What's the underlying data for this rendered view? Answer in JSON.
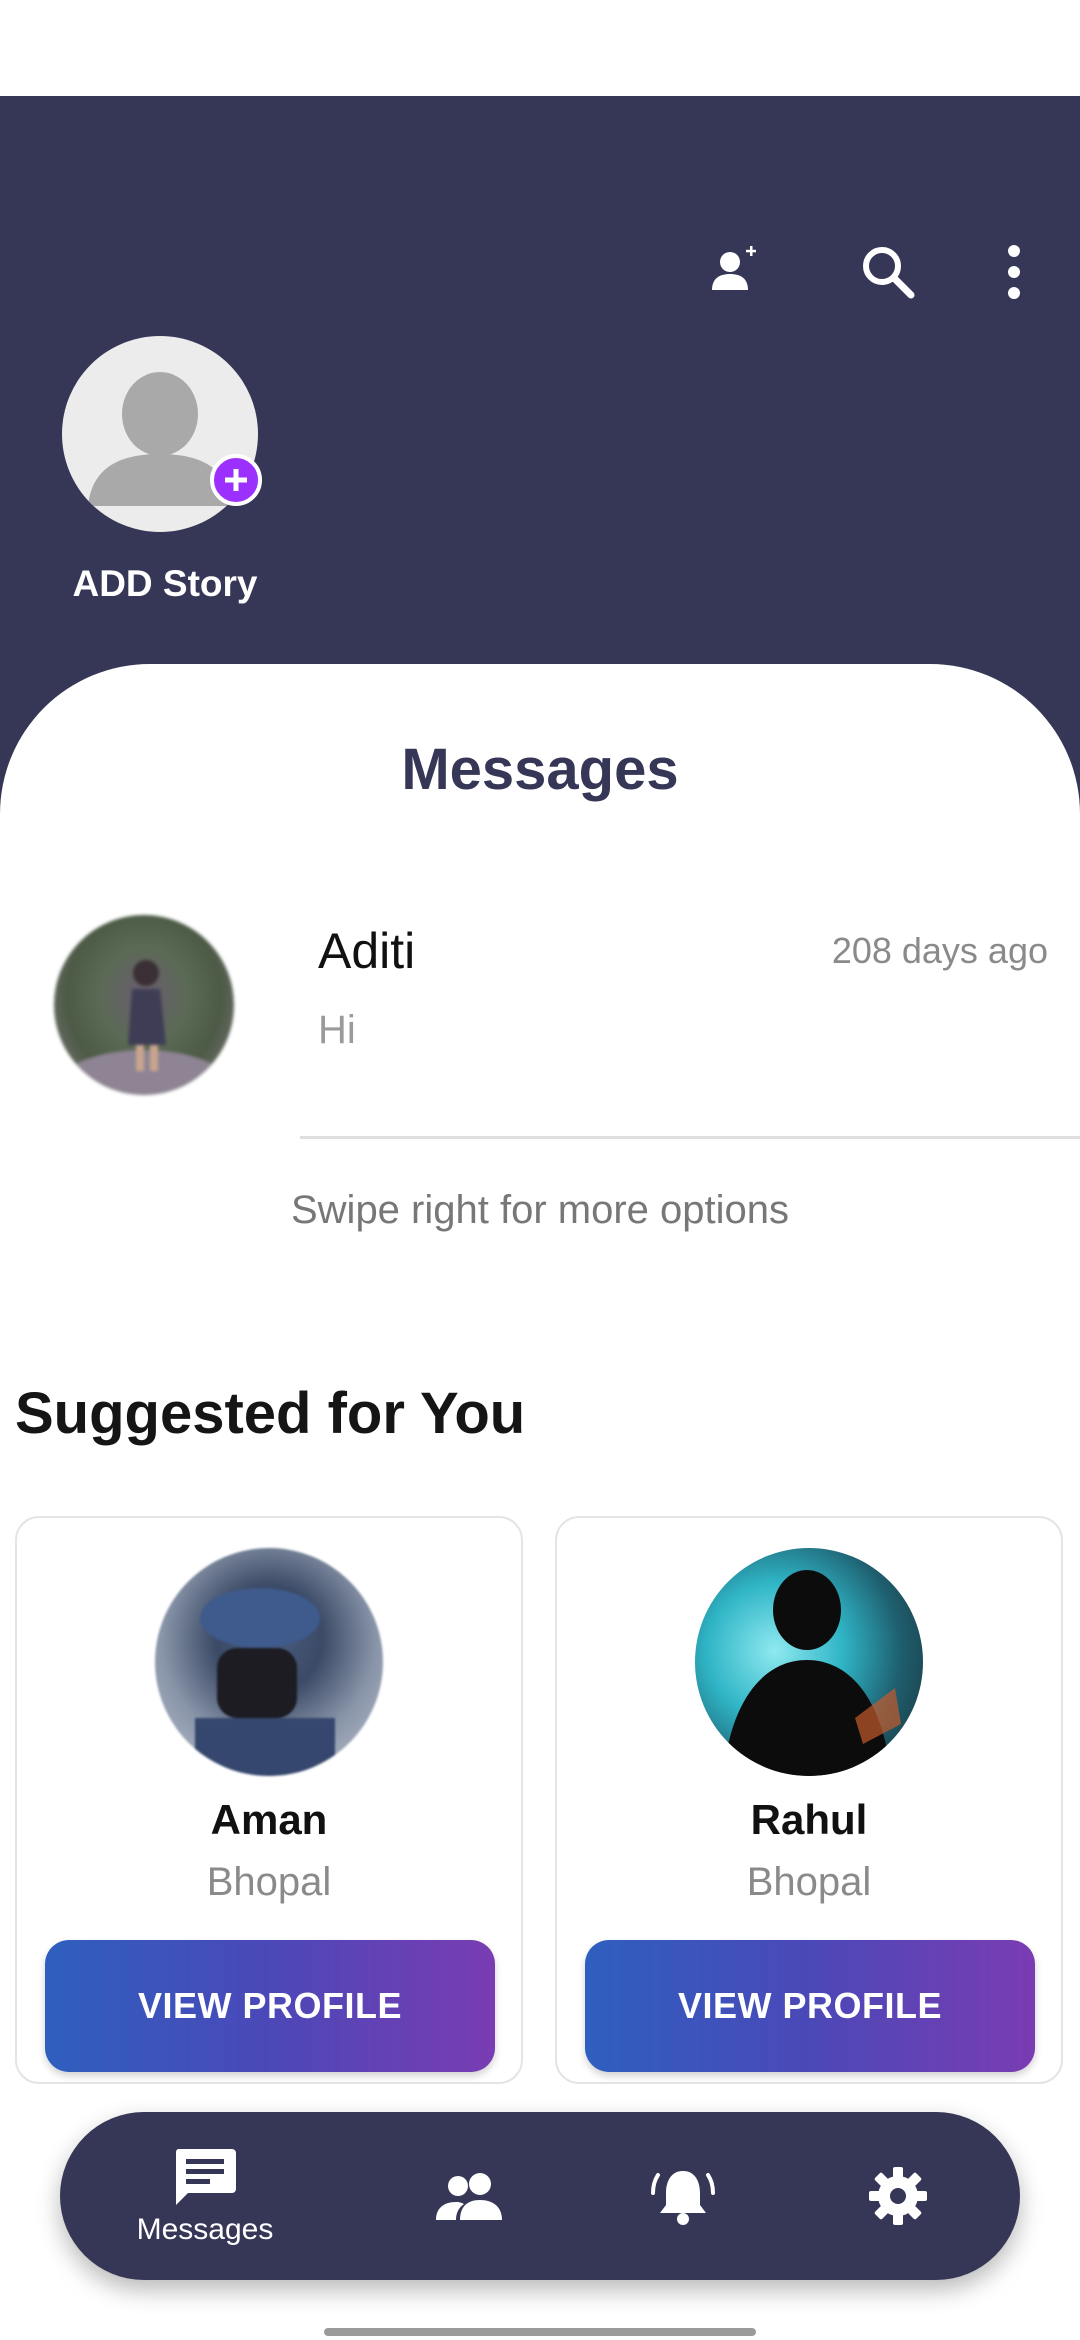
{
  "header": {
    "icons": {
      "add_contact": "person-add-icon",
      "search": "search-icon",
      "more": "more-vertical-icon"
    },
    "story": {
      "label": "ADD Story",
      "avatar_icon": "person-placeholder-icon",
      "badge_icon": "plus-icon"
    }
  },
  "messages": {
    "title": "Messages",
    "conversations": [
      {
        "name": "Aditi",
        "preview": "Hi",
        "time": "208 days ago"
      }
    ],
    "hint": "Swipe right for more options"
  },
  "suggested": {
    "title": "Suggested for You",
    "cards": [
      {
        "name": "Aman",
        "city": "Bhopal",
        "button": "VIEW PROFILE"
      },
      {
        "name": "Rahul",
        "city": "Bhopal",
        "button": "VIEW PROFILE"
      }
    ]
  },
  "bottom_nav": {
    "items": [
      {
        "label": "Messages",
        "icon": "chat-icon",
        "active": true
      },
      {
        "label": "",
        "icon": "people-icon",
        "active": false
      },
      {
        "label": "",
        "icon": "bell-ringing-icon",
        "active": false
      },
      {
        "label": "",
        "icon": "gear-icon",
        "active": false
      }
    ]
  },
  "colors": {
    "header_bg": "#363657",
    "accent_purple": "#9b30ff",
    "button_gradient_start": "#2e5fbf",
    "button_gradient_end": "#7a3cb2"
  }
}
